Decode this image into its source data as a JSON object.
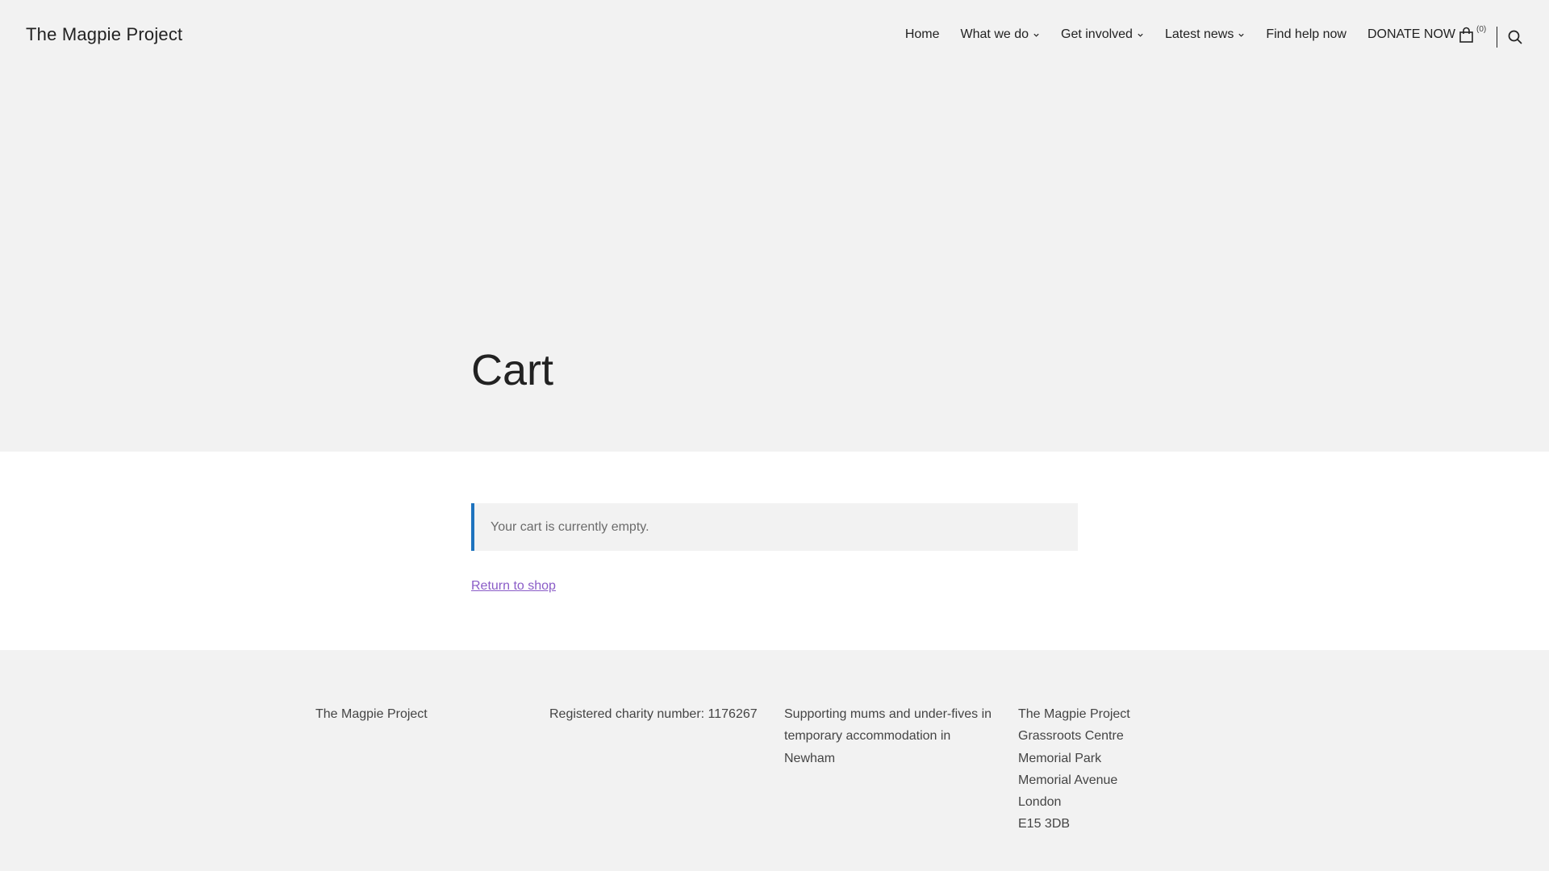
{
  "header": {
    "site_title": "The Magpie Project",
    "nav": [
      {
        "label": "Home",
        "has_dropdown": false
      },
      {
        "label": "What we do",
        "has_dropdown": true
      },
      {
        "label": "Get involved",
        "has_dropdown": true
      },
      {
        "label": "Latest news",
        "has_dropdown": true
      },
      {
        "label": "Find help now",
        "has_dropdown": false
      },
      {
        "label": "DONATE NOW",
        "has_dropdown": false
      }
    ],
    "cart_count": "(0)",
    "icons": {
      "cart": "shopping-bag-icon",
      "search": "search-icon",
      "dropdown": "chevron-down-icon"
    }
  },
  "page": {
    "title": "Cart"
  },
  "cart": {
    "empty_notice": "Your cart is currently empty.",
    "return_link": "Return to shop"
  },
  "footer": {
    "col1": [
      "The Magpie Project"
    ],
    "col2": [
      "Registered charity number: 1176267"
    ],
    "col3": [
      "Supporting mums and under-fives in",
      "temporary accommodation in",
      "Newham"
    ],
    "col4": [
      "The Magpie Project",
      "Grassroots Centre",
      "Memorial Park",
      "Memorial Avenue",
      "London",
      "E15 3DB"
    ]
  },
  "colors": {
    "background": "#f2f2f2",
    "content_background": "#ffffff",
    "notice_accent": "#1e73be",
    "link": "#8a5cc7",
    "text": "#222222"
  }
}
